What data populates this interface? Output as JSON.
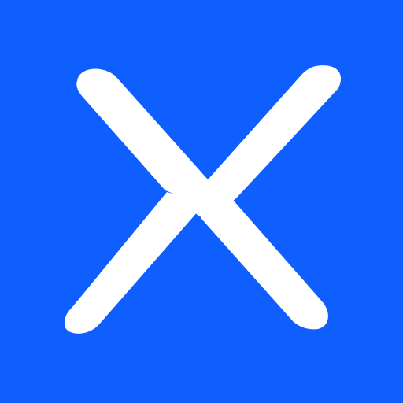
{
  "icon": {
    "name": "x-logo-icon",
    "colors": {
      "background": "#0F5FFF",
      "mark": "#FFFFFF"
    }
  }
}
